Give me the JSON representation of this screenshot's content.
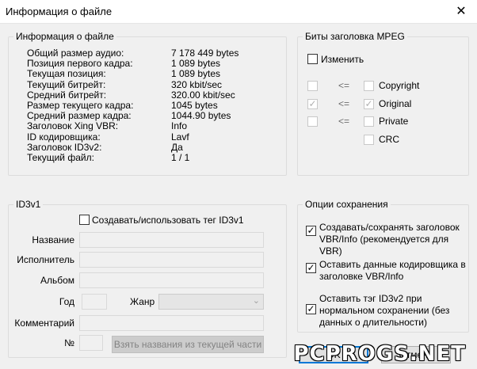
{
  "window": {
    "title": "Информация о файле",
    "close_glyph": "✕"
  },
  "file_info": {
    "legend": "Информация о файле",
    "rows": [
      {
        "label": "Общий размер аудио:",
        "value": "7 178 449 bytes"
      },
      {
        "label": "Позиция первого кадра:",
        "value": "1 089 bytes"
      },
      {
        "label": "Текущая позиция:",
        "value": "1 089 bytes"
      },
      {
        "label": "Текущий битрейт:",
        "value": "320 kbit/sec"
      },
      {
        "label": "Средний битрейт:",
        "value": "320.00 kbit/sec"
      },
      {
        "label": "Размер текущего кадра:",
        "value": "1045 bytes"
      },
      {
        "label": "Средний размер кадра:",
        "value": "1044.90 bytes"
      },
      {
        "label": "Заголовок Xing VBR:",
        "value": "Info"
      },
      {
        "label": "ID кодировщика:",
        "value": "Lavf"
      },
      {
        "label": "Заголовок ID3v2:",
        "value": "Да"
      },
      {
        "label": "Текущий файл:",
        "value": "1 / 1"
      }
    ]
  },
  "mpeg": {
    "legend": "Биты заголовка MPEG",
    "modify_label": "Изменить",
    "arrow": "<=",
    "copyright_label": "Copyright",
    "original_label": "Original",
    "private_label": "Private",
    "crc_label": "CRC",
    "check_glyph": "✓"
  },
  "id3v1": {
    "legend": "ID3v1",
    "create_label": "Создавать/использовать тег ID3v1",
    "title_label": "Название",
    "artist_label": "Исполнитель",
    "album_label": "Альбом",
    "year_label": "Год",
    "genre_label": "Жанр",
    "comment_label": "Комментарий",
    "track_label": "№",
    "fetch_button": "Взять названия из текущей части",
    "chevron": "⌄"
  },
  "save_options": {
    "legend": "Опции сохранения",
    "opt1": "Создавать/сохранять заголовок VBR/Info (рекомендуется для VBR)",
    "opt2": "Оставить данные кодировщика в заголовке VBR/Info",
    "opt3": "Оставить тэг ID3v2 при нормальном сохранении (без данных о длительности)"
  },
  "buttons": {
    "ok": "OK",
    "cancel": "Отмена"
  },
  "watermark": "PCPROGS.NET"
}
